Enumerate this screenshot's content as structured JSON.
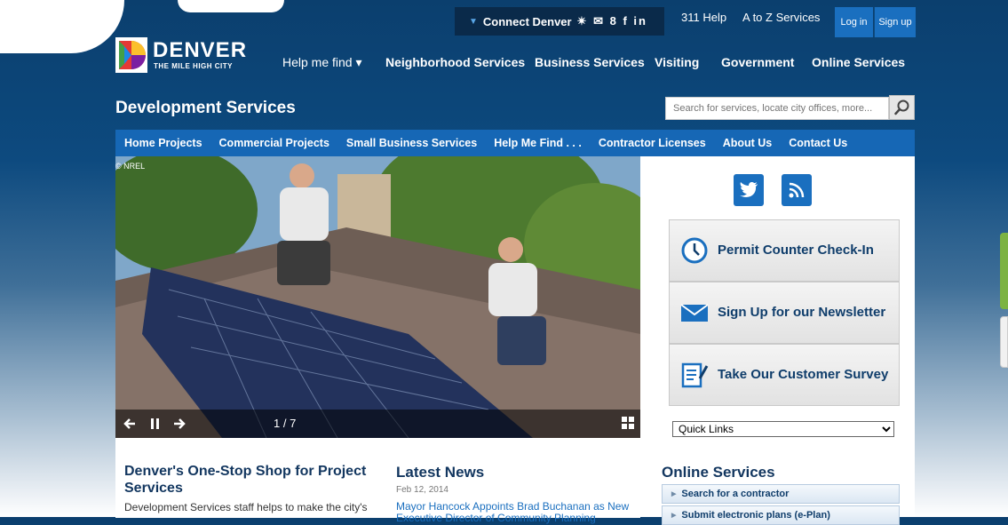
{
  "topbar": {
    "connect_label": "Connect Denver",
    "social_glyphs": "✴ ✉ 8 f in",
    "link_311": "311 Help",
    "link_atoz": "A to Z Services",
    "login": "Log in",
    "signup": "Sign up"
  },
  "logo": {
    "name": "DENVER",
    "tagline": "THE MILE HIGH CITY"
  },
  "mainnav": [
    "Help me find ▾",
    "Neighborhood Services",
    "Business Services",
    "Visiting",
    "Government",
    "Online Services"
  ],
  "dept": {
    "title": "Development Services"
  },
  "search": {
    "placeholder": "Search for services, locate city offices, more..."
  },
  "subnav": [
    "Home Projects",
    "Commercial Projects",
    "Small Business Services",
    "Help Me Find . . .",
    "Contractor Licenses",
    "About Us",
    "Contact Us"
  ],
  "slider": {
    "credit": "© NREL",
    "counter": "1 / 7"
  },
  "promos": {
    "permit": "Permit Counter Check-In",
    "newsletter": "Sign Up for our Newsletter",
    "survey": "Take Our Customer Survey"
  },
  "quick_links": {
    "selected": "Quick Links"
  },
  "col1": {
    "title": "Denver's One-Stop Shop for Project Services",
    "body": "Development Services staff helps to make the city's"
  },
  "col2": {
    "title": "Latest News",
    "date": "Feb 12, 2014",
    "link": "Mayor Hancock Appoints Brad Buchanan as New Executive Director of Community Planning"
  },
  "col3": {
    "title": "Online Services",
    "items": [
      "Search for a contractor",
      "Submit electronic plans (e-Plan)"
    ]
  },
  "colors": {
    "brand_dark": "#0d4a7f",
    "brand_blue": "#1667b5",
    "link_blue": "#1a6fbf"
  }
}
